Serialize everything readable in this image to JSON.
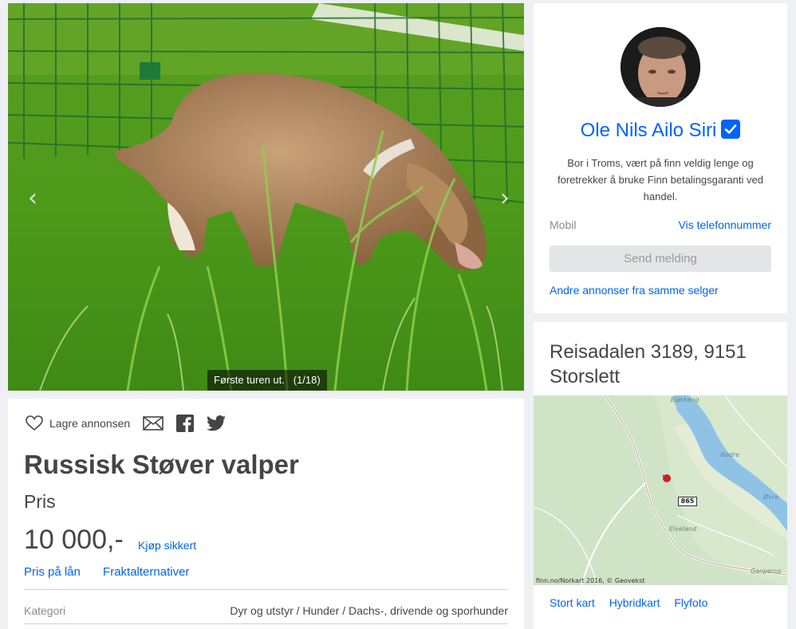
{
  "gallery": {
    "caption_text": "Første turen ut.",
    "caption_counter": "(1/18)",
    "prev_icon": "chevron-left-icon",
    "next_icon": "chevron-right-icon"
  },
  "listing": {
    "save_label": "Lagre annonsen",
    "icons": [
      "heart-icon",
      "mail-icon",
      "facebook-icon",
      "twitter-icon"
    ],
    "title": "Russisk Støver valper",
    "price_label": "Pris",
    "price_value": "10 000,-",
    "buy_safe_label": "Kjøp sikkert",
    "loan_link": "Pris på lån",
    "shipping_link": "Fraktalternativer",
    "category_label": "Kategori",
    "category_value": "Dyr og utstyr / Hunder / Dachs-, drivende og sporhunder"
  },
  "seller": {
    "name": "Ole Nils Ailo Siri",
    "description": "Bor i Troms, vært på finn veldig lenge og foretrekker å bruke Finn betalingsgaranti ved handel.",
    "mobile_label": "Mobil",
    "phone_link": "Vis telefonnummer",
    "send_button": "Send melding",
    "other_ads_link": "Andre annonser fra samme selger"
  },
  "location": {
    "address": "Reisadalen 3189, 9151 Storslett",
    "map_labels": {
      "bjorkeng": "Bjørkeng",
      "nedre": "Nedre",
      "ovre": "Øvre",
      "elveland": "Elveland",
      "ganperus": "Ganperus"
    },
    "road_number": "865",
    "map_copyright": "finn.no/Norkart 2016, © Geovekst",
    "map_links": [
      "Stort kart",
      "Hybridkart",
      "Flyfoto"
    ]
  },
  "colors": {
    "link": "#0063fb",
    "text": "#474445",
    "muted": "#8b8b8b",
    "background": "#eef0f3"
  }
}
